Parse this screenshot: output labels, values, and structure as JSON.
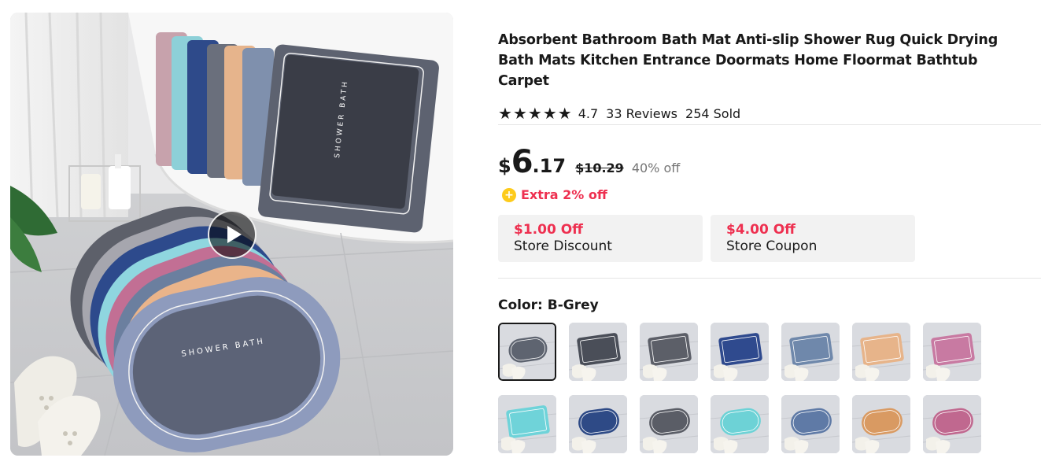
{
  "product": {
    "title": "Absorbent Bathroom Bath Mat Anti-slip Shower Rug Quick Drying Bath Mats Kitchen Entrance Doormats Home Floormat Bathtub Carpet",
    "rating": "4.7",
    "stars": 5,
    "reviews": "33 Reviews",
    "sold": "254 Sold",
    "image_mat_text": "SHOWER BATH"
  },
  "price": {
    "currency": "$",
    "integer": "6",
    "decimal": ".17",
    "original": "$10.29",
    "discount": "40% off",
    "extra": "Extra 2% off"
  },
  "coupons": [
    {
      "amount": "$1.00 Off",
      "label": "Store Discount"
    },
    {
      "amount": "$4.00 Off",
      "label": "Store Coupon"
    }
  ],
  "color": {
    "label": "Color: B-Grey",
    "selected_index": 0,
    "swatches": [
      {
        "name": "B-Grey",
        "color": "#5e6470",
        "shape": "oval"
      },
      {
        "name": "swatch-2",
        "color": "#4a4e58",
        "shape": "rect"
      },
      {
        "name": "swatch-3",
        "color": "#5c5f68",
        "shape": "rect"
      },
      {
        "name": "swatch-4",
        "color": "#2f4a8e",
        "shape": "rect"
      },
      {
        "name": "swatch-5",
        "color": "#6f88ab",
        "shape": "rect"
      },
      {
        "name": "swatch-6",
        "color": "#e7b48a",
        "shape": "rect"
      },
      {
        "name": "swatch-7",
        "color": "#c87aa2",
        "shape": "rect"
      },
      {
        "name": "swatch-8",
        "color": "#6fd3d9",
        "shape": "rect"
      },
      {
        "name": "swatch-9",
        "color": "#2e4a86",
        "shape": "oval"
      },
      {
        "name": "swatch-10",
        "color": "#5a5d66",
        "shape": "oval"
      },
      {
        "name": "swatch-11",
        "color": "#6dd2d6",
        "shape": "oval"
      },
      {
        "name": "swatch-12",
        "color": "#5f7aa6",
        "shape": "oval"
      },
      {
        "name": "swatch-13",
        "color": "#d99a62",
        "shape": "oval"
      },
      {
        "name": "swatch-14",
        "color": "#c0688f",
        "shape": "oval"
      }
    ]
  },
  "colors": {
    "accent_red": "#ee3050",
    "coin_yellow": "#fdcb1b",
    "text": "#191919",
    "muted": "#757575"
  }
}
